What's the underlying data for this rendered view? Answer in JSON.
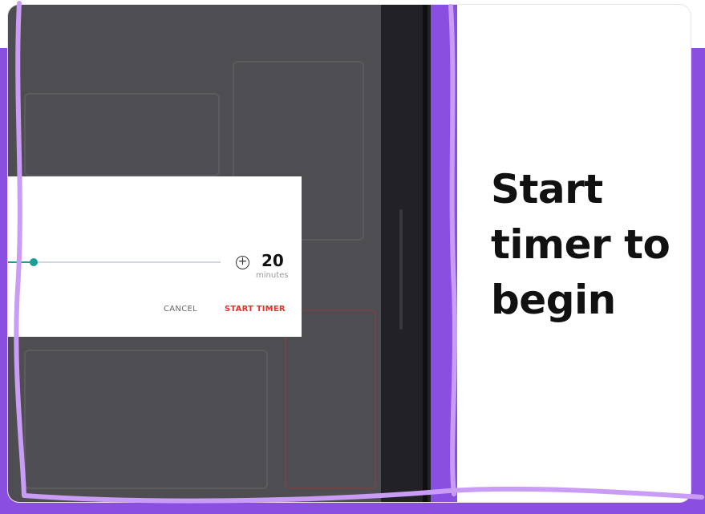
{
  "dialog": {
    "minutes_value": "20",
    "minutes_unit": "minutes",
    "cancel_label": "CANCEL",
    "start_label": "START TIMER",
    "plus_icon": "plus-circle-icon"
  },
  "panel": {
    "headline_line1": "Start",
    "headline_line2": "timer to",
    "headline_line3": "begin"
  },
  "colors": {
    "brand_purple": "#8a4fe0",
    "outline_lavender": "#c99cf5",
    "accent_teal": "#1a9e96",
    "start_red": "#e5322d"
  }
}
